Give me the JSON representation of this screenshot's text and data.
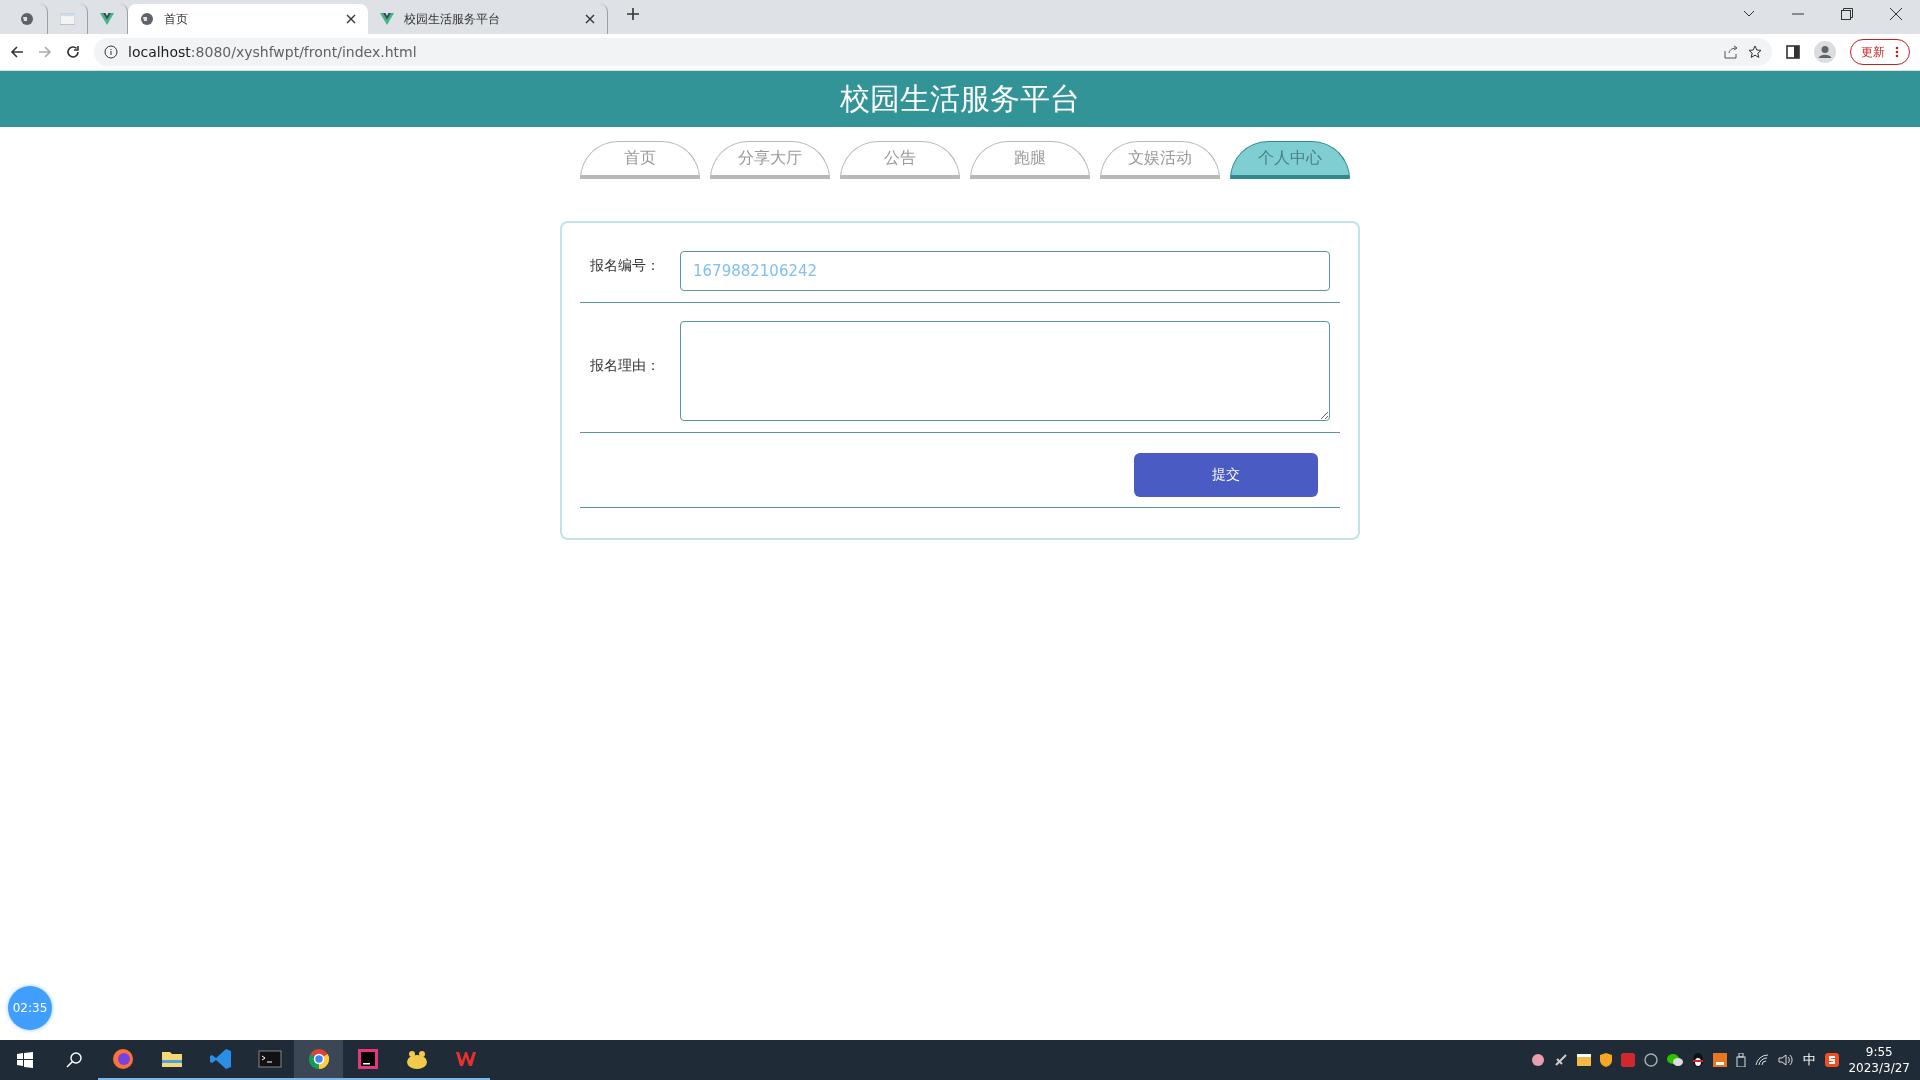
{
  "browser": {
    "tabs": [
      {
        "kind": "globe",
        "selected": false
      },
      {
        "kind": "page",
        "selected": false
      },
      {
        "kind": "vue",
        "selected": false
      },
      {
        "kind": "globe",
        "title": "首页",
        "selected": true
      },
      {
        "kind": "vue",
        "title": "校园生活服务平台",
        "selected": false
      }
    ],
    "url_host": "localhost",
    "url_rest": ":8080/xyshfwpt/front/index.html",
    "update_label": "更新"
  },
  "header": {
    "title": "校园生活服务平台"
  },
  "nav": [
    {
      "label": "首页",
      "selected": false
    },
    {
      "label": "分享大厅",
      "selected": false
    },
    {
      "label": "公告",
      "selected": false
    },
    {
      "label": "跑腿",
      "selected": false
    },
    {
      "label": "文娱活动",
      "selected": false
    },
    {
      "label": "个人中心",
      "selected": true
    }
  ],
  "form": {
    "fields": [
      {
        "kind": "input",
        "label": "报名编号：",
        "value": "1679882106242"
      },
      {
        "kind": "textarea",
        "label": "报名理由："
      }
    ],
    "submit": "提交"
  },
  "timer": "02:35",
  "taskbar": {
    "apps": [
      {
        "kind": "firefox",
        "selected": false
      },
      {
        "kind": "folder",
        "selected": false
      },
      {
        "kind": "vscode",
        "selected": false
      },
      {
        "kind": "terminal",
        "selected": false
      },
      {
        "kind": "chrome",
        "selected": true
      },
      {
        "kind": "idea",
        "selected": false
      },
      {
        "kind": "blob",
        "selected": false
      },
      {
        "kind": "wps",
        "selected": false
      }
    ],
    "ime": "中",
    "time": "9:55",
    "date": "2023/3/27"
  }
}
